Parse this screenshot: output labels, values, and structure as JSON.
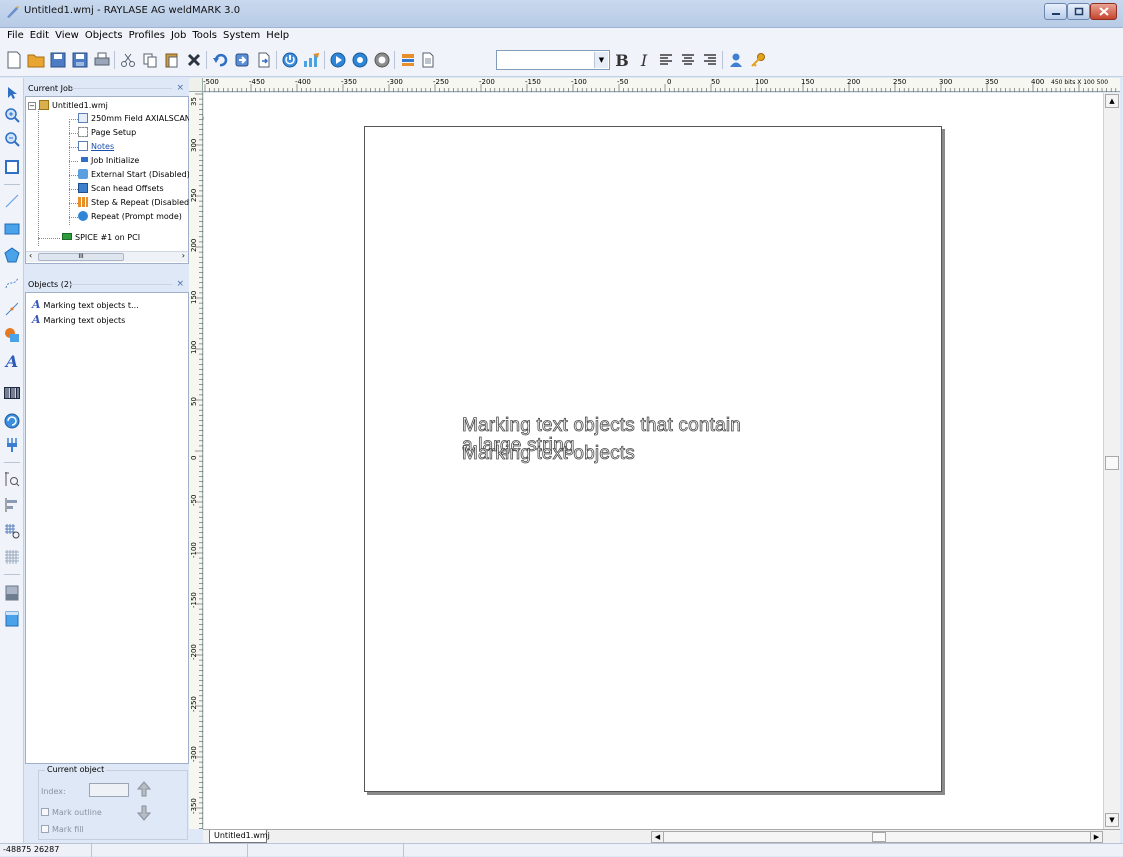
{
  "window": {
    "title": "Untitled1.wmj - RAYLASE AG weldMARK 3.0"
  },
  "menu": [
    "File",
    "Edit",
    "View",
    "Objects",
    "Profiles",
    "Job",
    "Tools",
    "System",
    "Help"
  ],
  "toolbar": {
    "font_combo_value": "",
    "buttons": [
      "new-icon",
      "open-icon",
      "save-icon",
      "save-all-icon",
      "print-icon",
      "cut-icon",
      "copy-icon",
      "paste-icon",
      "delete-icon",
      "undo-icon",
      "import-icon",
      "export-icon",
      "laser-icon",
      "mark-icon",
      "start-icon",
      "preview-icon",
      "stop-icon",
      "layers-icon",
      "report-icon",
      "bold-icon",
      "italic-icon",
      "align-left-icon",
      "align-center-icon",
      "align-right-icon",
      "user-icon",
      "key-icon"
    ],
    "bold_label": "B",
    "italic_label": "I"
  },
  "current_job": {
    "header": "Current Job",
    "items": [
      {
        "label": "Untitled1.wmj",
        "icon": "job-icon"
      },
      {
        "label": "250mm Field AXIALSCAN-30",
        "icon": "field-icon"
      },
      {
        "label": "Page Setup",
        "icon": "page-setup-icon"
      },
      {
        "label": "Notes",
        "icon": "notes-icon"
      },
      {
        "label": "Job Initialize",
        "icon": "job-init-icon"
      },
      {
        "label": "External Start (Disabled)",
        "icon": "external-start-icon"
      },
      {
        "label": "Scan head Offsets",
        "icon": "scan-head-icon"
      },
      {
        "label": "Step & Repeat (Disabled)",
        "icon": "step-repeat-icon"
      },
      {
        "label": "Repeat (Prompt mode)",
        "icon": "repeat-icon"
      },
      {
        "label": "SPICE #1 on PCI",
        "icon": "card-icon"
      }
    ]
  },
  "objects": {
    "header": "Objects  (2)",
    "items": [
      {
        "label": "Marking text objects t..."
      },
      {
        "label": "Marking text objects"
      }
    ]
  },
  "current_object": {
    "legend": "Current object",
    "index_label": "Index:",
    "mark_outline": "Mark outline",
    "mark_fill": "Mark fill"
  },
  "ruler_top": {
    "labels": [
      "-500",
      "-450",
      "-400",
      "-350",
      "-300",
      "-250",
      "-200",
      "-150",
      "-100",
      "-50",
      "0",
      "50",
      "100",
      "150",
      "200",
      "250",
      "300",
      "350",
      "400"
    ],
    "unit_label": "450 bits X 100 500"
  },
  "ruler_left": {
    "labels": [
      "35",
      "300",
      "250",
      "200",
      "150",
      "100",
      "50",
      "0",
      "-50",
      "-100",
      "-150",
      "-200",
      "-250",
      "-300",
      "-350"
    ]
  },
  "canvas": {
    "text1": "Marking text objects that contain",
    "text1_line2": "a large string",
    "text2": "Marking text objects"
  },
  "document_tab": "Untitled1.wmj",
  "status": {
    "coords": "-48875 26287"
  }
}
